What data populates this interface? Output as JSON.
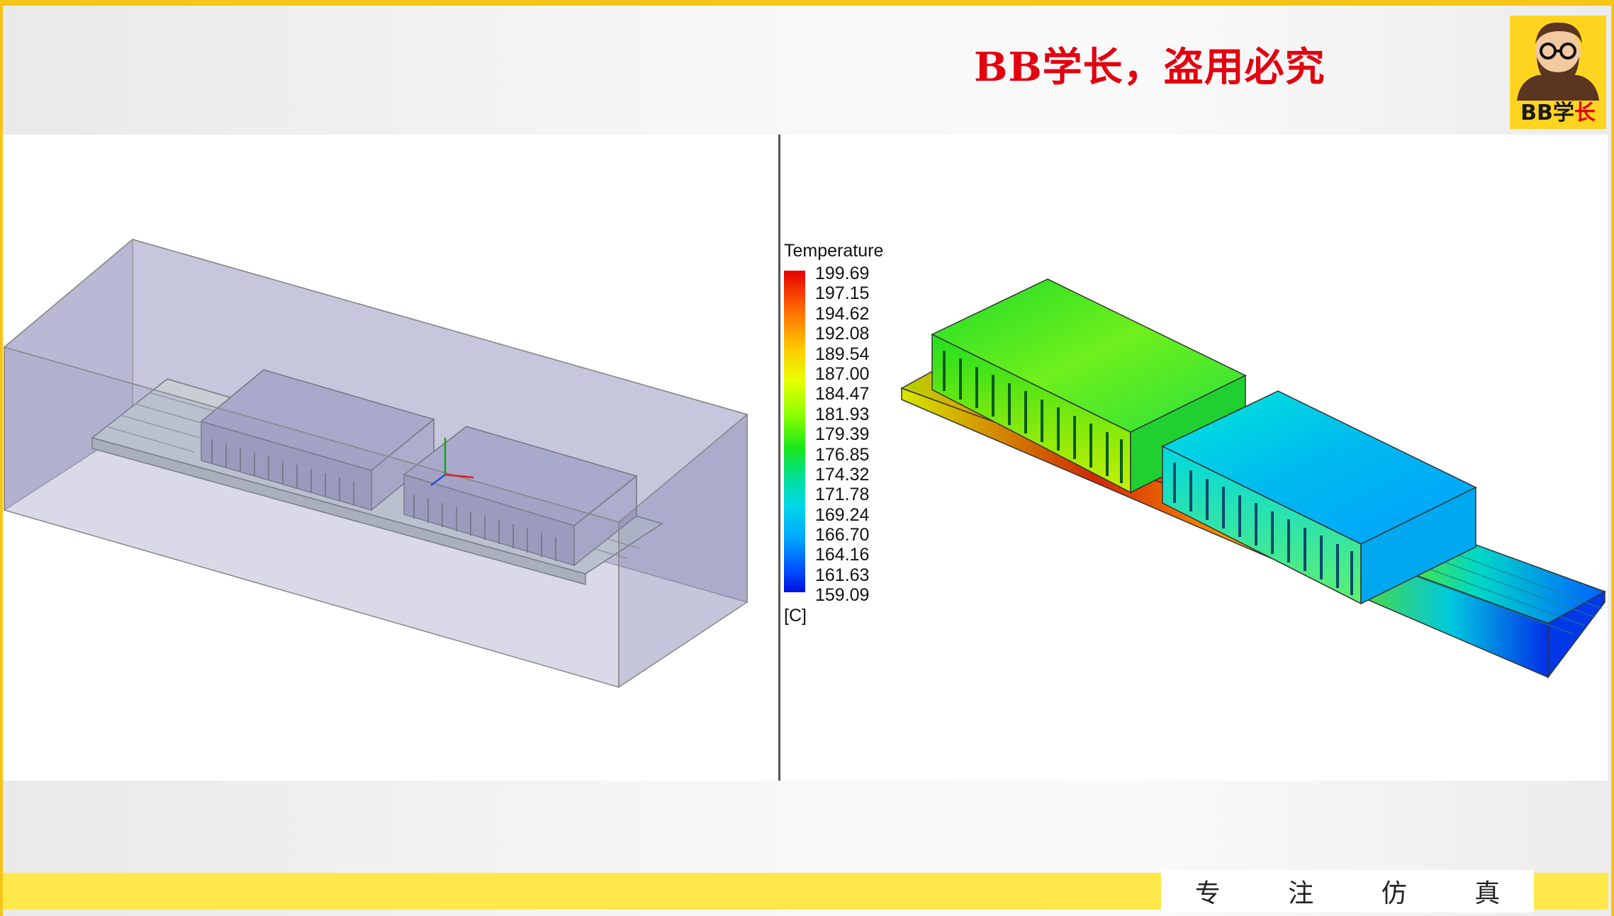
{
  "header": {
    "banner_text": "BB学长，盗用必究",
    "logo_text_main": "BB学",
    "logo_text_accent": "长"
  },
  "legend": {
    "title": "Temperature",
    "unit": "[C]",
    "values": [
      "199.69",
      "197.15",
      "194.62",
      "192.08",
      "189.54",
      "187.00",
      "184.47",
      "181.93",
      "179.39",
      "176.85",
      "174.32",
      "171.78",
      "169.24",
      "166.70",
      "164.16",
      "161.63",
      "159.09"
    ]
  },
  "footer": {
    "motto": [
      "专",
      "注",
      "仿",
      "真"
    ]
  },
  "colors": {
    "frame": "#f5c518",
    "banner": "#e3000f",
    "bottom_bar": "#ffe94a"
  }
}
